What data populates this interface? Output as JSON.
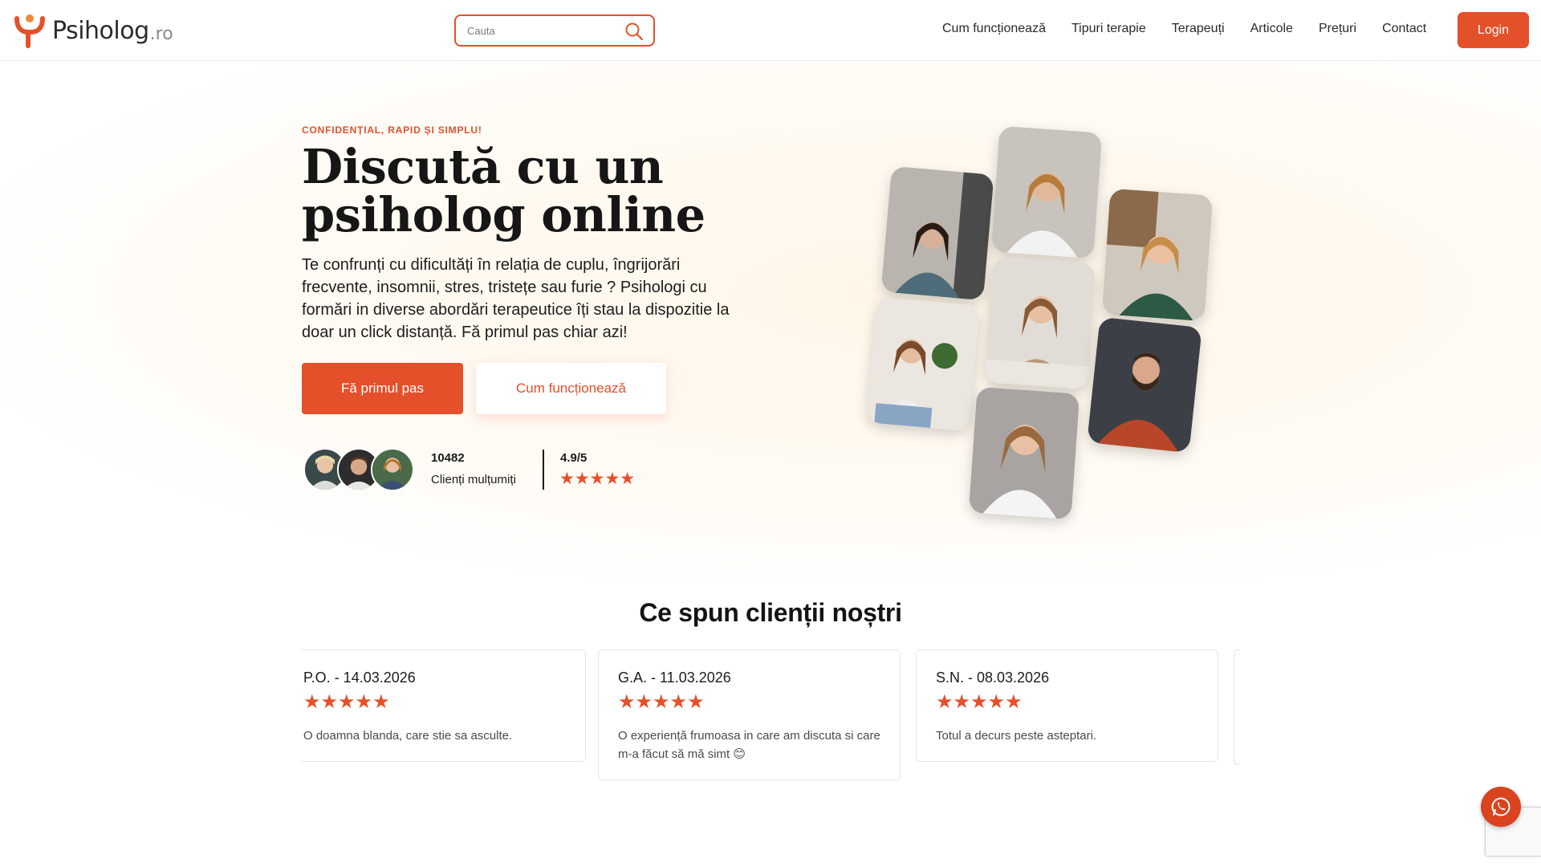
{
  "header": {
    "logo_text": "Psiholog",
    "logo_suffix": ".ro",
    "search_placeholder": "Cauta",
    "nav": [
      "Cum funcționează",
      "Tipuri terapie",
      "Terapeuți",
      "Articole",
      "Prețuri",
      "Contact"
    ],
    "login_label": "Login",
    "accent_color": "#e4502a"
  },
  "hero": {
    "eyebrow": "CONFIDENȚIAL, RAPID ȘI SIMPLU!",
    "title": "Discută cu un psiholog online",
    "description": "Te confrunți cu dificultăți în relația de cuplu, îngrijorări frecvente, insomnii, stres, tristețe sau furie ? Psihologi cu formări in diverse abordări terapeutice îți stau la dispozitie la doar un click distanță. Fă primul pas chiar azi!",
    "primary_cta": "Fă primul pas",
    "secondary_cta": "Cum funcționează",
    "clients_count": "10482",
    "clients_label": "Clienți mulțumiți",
    "rating_value": "4.9/5",
    "rating_stars": "★★★★★"
  },
  "testimonials": {
    "title": "Ce spun clienții noștri",
    "reviews": [
      {
        "author": "P.O. - 14.03.2026",
        "stars": "★★★★★",
        "text": "O doamna blanda, care stie sa asculte."
      },
      {
        "author": "G.A. - 11.03.2026",
        "stars": "★★★★★",
        "text": "O experiență frumoasa in care am discuta si care m-a făcut să mă simt 😊"
      },
      {
        "author": "S.N. - 08.03.2026",
        "stars": "★★★★★",
        "text": "Totul a decurs peste asteptari."
      }
    ]
  },
  "icons": {
    "search": "search-icon",
    "whatsapp": "whatsapp-icon",
    "logo": "psiholog-logo-icon"
  }
}
